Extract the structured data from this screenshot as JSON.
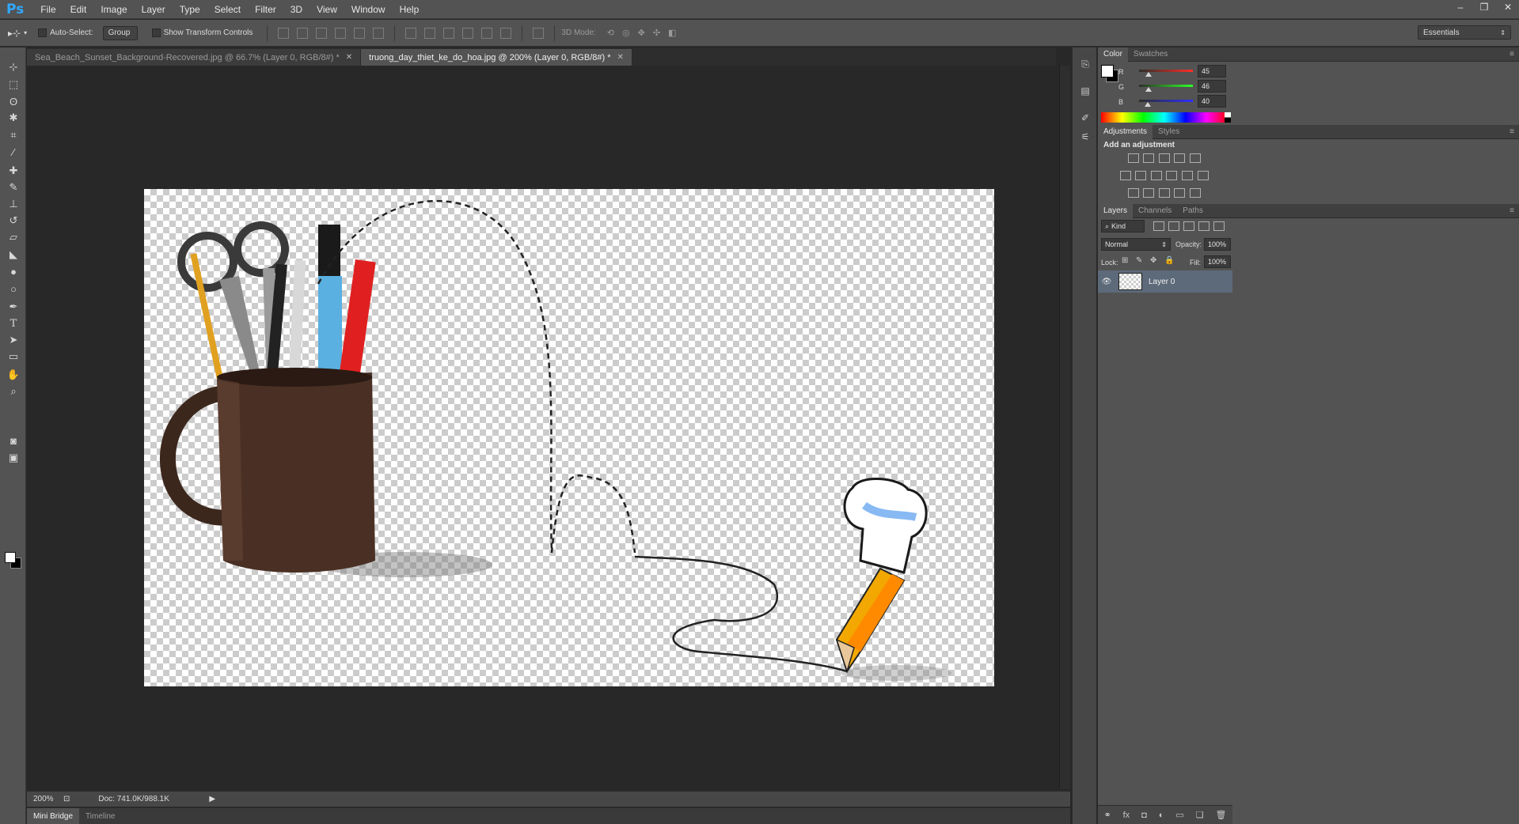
{
  "app": {
    "logo": "Ps",
    "menu": [
      "File",
      "Edit",
      "Image",
      "Layer",
      "Type",
      "Select",
      "Filter",
      "3D",
      "View",
      "Window",
      "Help"
    ],
    "window_controls": [
      "‒",
      "❐",
      "✕"
    ]
  },
  "options_bar": {
    "auto_select_label": "Auto-Select:",
    "auto_select_value": "Group",
    "show_transform_label": "Show Transform Controls",
    "mode_3d_label": "3D Mode:",
    "workspace": "Essentials"
  },
  "tools": [
    "move-tool",
    "marquee-tool",
    "lasso-tool",
    "magic-wand-tool",
    "crop-tool",
    "eyedropper-tool",
    "healing-brush-tool",
    "brush-tool",
    "clone-stamp-tool",
    "history-brush-tool",
    "eraser-tool",
    "paint-bucket-tool",
    "blur-tool",
    "dodge-tool",
    "pen-tool",
    "type-tool",
    "path-selection-tool",
    "rectangle-tool",
    "hand-tool",
    "zoom-tool"
  ],
  "documents": [
    {
      "title": "Sea_Beach_Sunset_Background-Recovered.jpg @ 66.7% (Layer 0, RGB/8#) *",
      "active": false
    },
    {
      "title": "truong_day_thiet_ke_do_hoa.jpg @ 200% (Layer 0, RGB/8#) *",
      "active": true
    }
  ],
  "status": {
    "zoom": "200%",
    "doc_size": "Doc: 741.0K/988.1K"
  },
  "bottom_tabs": [
    "Mini Bridge",
    "Timeline"
  ],
  "color_panel": {
    "tabs": [
      "Color",
      "Swatches"
    ],
    "r_label": "R",
    "r": "45",
    "g_label": "G",
    "g": "46",
    "b_label": "B",
    "b": "40",
    "colors": {
      "r_track": "#e02020",
      "g_track": "#20b020",
      "b_track": "#2040e0"
    }
  },
  "adjustments_panel": {
    "tabs": [
      "Adjustments",
      "Styles"
    ],
    "heading": "Add an adjustment"
  },
  "layers_panel": {
    "tabs": [
      "Layers",
      "Channels",
      "Paths"
    ],
    "filter_kind": "Kind",
    "blend_mode": "Normal",
    "opacity_label": "Opacity:",
    "opacity": "100%",
    "lock_label": "Lock:",
    "fill_label": "Fill:",
    "fill": "100%",
    "layers": [
      {
        "name": "Layer 0",
        "visible": true
      }
    ],
    "footer_icons": [
      "link-icon",
      "fx-icon",
      "mask-icon",
      "adjustment-icon",
      "folder-icon",
      "new-layer-icon",
      "trash-icon"
    ],
    "footer_glyphs": [
      "⚭",
      "fx",
      "◘",
      "◐",
      "▭",
      "❏",
      "🗑"
    ]
  }
}
